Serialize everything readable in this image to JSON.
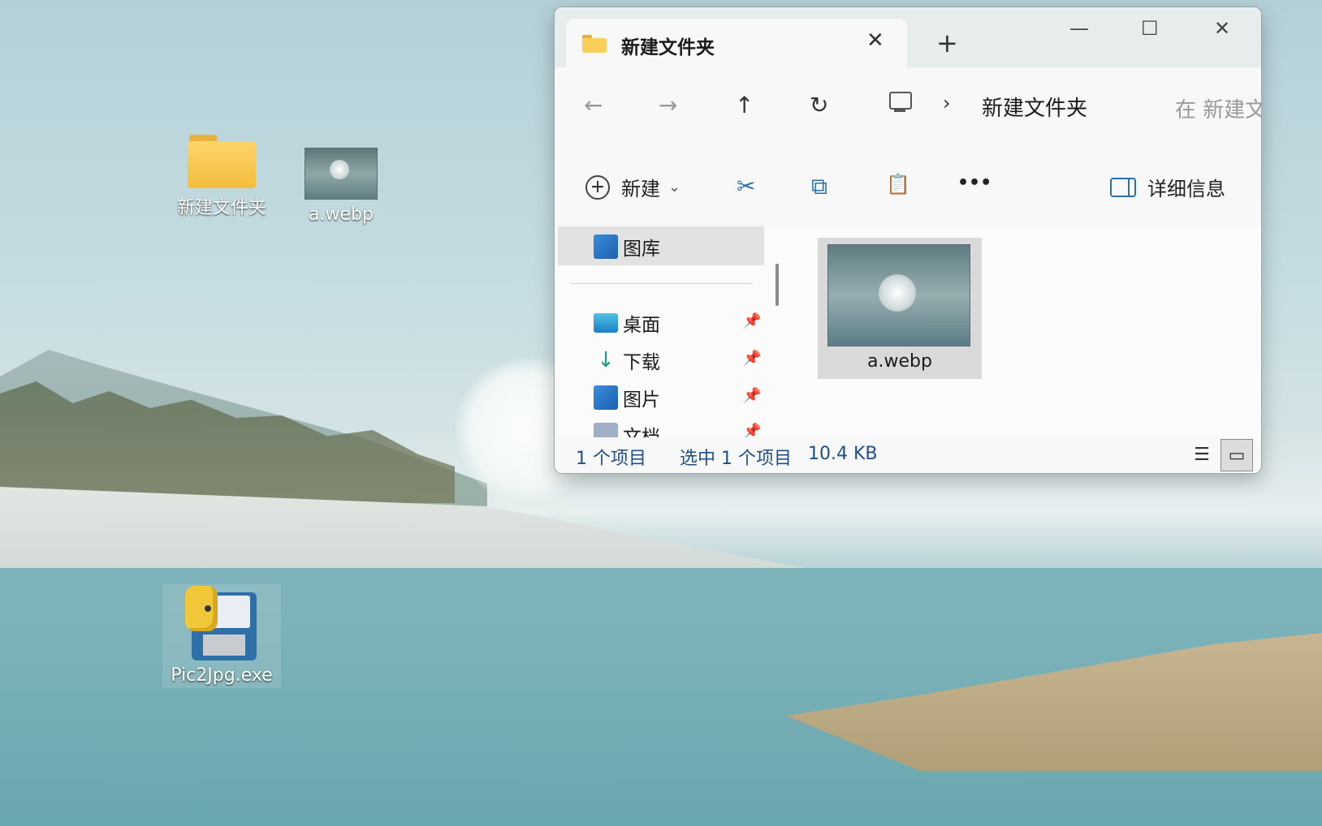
{
  "desktop": {
    "icons": [
      {
        "label": "新建文件夹"
      },
      {
        "label": "a.webp"
      },
      {
        "label": "Pic2Jpg.exe"
      }
    ]
  },
  "explorer": {
    "tab_title": "新建文件夹",
    "tab_close": "✕",
    "tab_add": "+",
    "window_controls": {
      "minimize": "—",
      "maximize": "☐",
      "close": "✕"
    },
    "nav": {
      "back": "←",
      "forward": "→",
      "up": "↑",
      "refresh": "↻"
    },
    "breadcrumb_separator": "›",
    "breadcrumb": "新建文件夹",
    "search_placeholder": "在 新建文",
    "toolbar": {
      "new_label": "新建",
      "new_chevron": "⌄",
      "cut_icon": "✂",
      "copy_icon": "⧉",
      "paste_icon": "📋",
      "more": "•••",
      "details_label": "详细信息"
    },
    "sidebar": {
      "gallery": "图库",
      "items": [
        {
          "label": "桌面"
        },
        {
          "label": "下载"
        },
        {
          "label": "图片"
        },
        {
          "label": "文档"
        }
      ],
      "pin_glyph": "📌"
    },
    "files": [
      {
        "name": "a.webp"
      }
    ],
    "status": {
      "count": "1 个项目",
      "selection": "选中 1 个项目",
      "size": "10.4 KB"
    },
    "view_icons": {
      "details": "☰",
      "large": "▭"
    }
  }
}
